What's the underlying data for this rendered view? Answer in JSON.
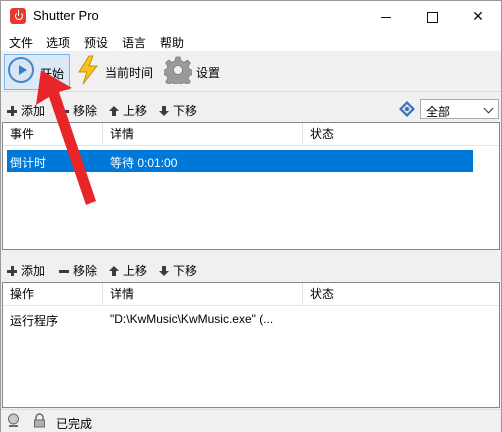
{
  "window": {
    "title": "Shutter Pro",
    "controls": {
      "minimize": "",
      "maximize": "",
      "close": "✕"
    }
  },
  "menu": [
    "文件",
    "选项",
    "预设",
    "语言",
    "帮助"
  ],
  "toolbar": {
    "start_label": "开始",
    "current_time_label": "当前时间",
    "settings_label": "设置"
  },
  "events_bar": {
    "add_label": "添加",
    "remove_label": "移除",
    "move_up_label": "上移",
    "move_down_label": "下移",
    "filter_selected": "全部"
  },
  "events_table": {
    "columns": [
      "事件",
      "详情",
      "状态"
    ],
    "rows": [
      {
        "event": "倒计时",
        "detail": "等待 0:01:00",
        "status": "",
        "selected": true
      }
    ]
  },
  "actions_bar": {
    "add_label": "添加",
    "remove_label": "移除",
    "move_up_label": "上移",
    "move_down_label": "下移"
  },
  "actions_table": {
    "columns": [
      "操作",
      "详情",
      "状态"
    ],
    "rows": [
      {
        "action": "运行程序",
        "detail": "\"D:\\KwMusic\\KwMusic.exe\" (...",
        "status": ""
      }
    ]
  },
  "status_bar": {
    "text": "已完成"
  },
  "colors": {
    "selection": "#0078d7",
    "annotation_arrow": "#e8262a",
    "app_icon": "#e63a2e"
  }
}
